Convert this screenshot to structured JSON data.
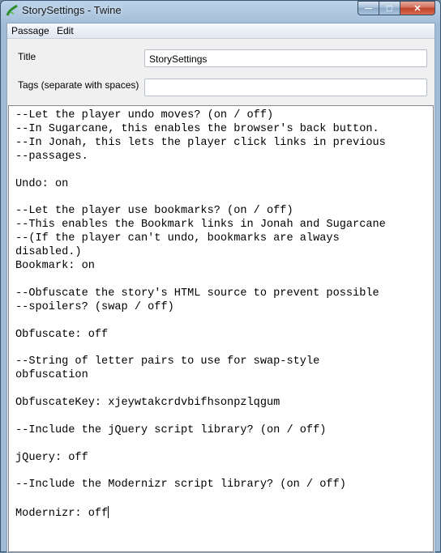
{
  "window": {
    "title": "StorySettings - Twine",
    "controls": {
      "minimize": "—",
      "maximize": "□",
      "close": "✕"
    }
  },
  "menubar": {
    "items": [
      "Passage",
      "Edit"
    ]
  },
  "form": {
    "title_label": "Title",
    "title_value": "StorySettings",
    "tags_label": "Tags (separate with spaces)",
    "tags_value": ""
  },
  "editor": {
    "lines": [
      "--Let the player undo moves? (on / off)",
      "--In Sugarcane, this enables the browser's back button.",
      "--In Jonah, this lets the player click links in previous",
      "--passages.",
      "",
      "Undo: on",
      "",
      "--Let the player use bookmarks? (on / off)",
      "--This enables the Bookmark links in Jonah and Sugarcane",
      "--(If the player can't undo, bookmarks are always",
      "disabled.)",
      "Bookmark: on",
      "",
      "--Obfuscate the story's HTML source to prevent possible",
      "--spoilers? (swap / off)",
      "",
      "Obfuscate: off",
      "",
      "--String of letter pairs to use for swap-style",
      "obfuscation",
      "",
      "ObfuscateKey: xjeywtakcrdvbifhsonpzlqgum",
      "",
      "--Include the jQuery script library? (on / off)",
      "",
      "jQuery: off",
      "",
      "--Include the Modernizr script library? (on / off)",
      "",
      "Modernizr: off"
    ]
  },
  "colors": {
    "accent": "#3b5573",
    "close": "#c0412a",
    "editor_bg": "#ffffff"
  }
}
